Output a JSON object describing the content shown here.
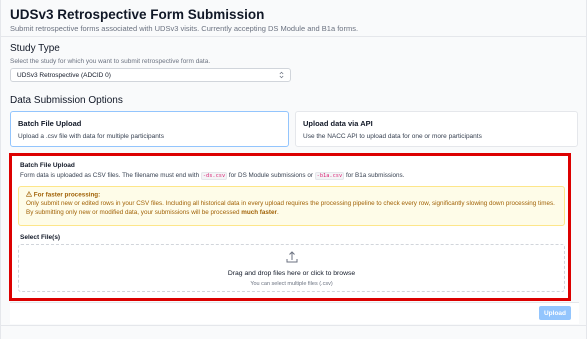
{
  "header": {
    "title": "UDSv3 Retrospective Form Submission",
    "subtitle": "Submit retrospective forms associated with UDSv3 visits. Currently accepting DS Module and B1a forms."
  },
  "study_type": {
    "heading": "Study Type",
    "help": "Select the study for which you want to submit retrospective form data.",
    "selected": "UDSv3 Retrospective (ADCID 0)",
    "chevron": "⌃⌄"
  },
  "options": {
    "heading": "Data Submission Options",
    "cards": [
      {
        "title": "Batch File Upload",
        "desc": "Upload a .csv file with data for multiple participants",
        "active": true
      },
      {
        "title": "Upload data via API",
        "desc": "Use the NACC API to upload data for one or more participants",
        "active": false
      }
    ]
  },
  "batch": {
    "title": "Batch File Upload",
    "desc_part1": "Form data is uploaded as CSV files. The filename must end with",
    "code1": "-ds.csv",
    "desc_part2": "for DS Module submissions or",
    "code2": "-b1a.csv",
    "desc_part3": "for B1a submissions.",
    "warning": {
      "title": "For faster processing:",
      "line1": "Only submit new or edited rows in your CSV files. Including all historical data in every upload requires the processing pipeline to check every row, significantly slowing down processing times.",
      "line2_start": "By submitting only new or modified data, your submissions will be processed",
      "line2_bold": "much faster",
      "line2_end": "."
    },
    "files_label": "Select File(s)",
    "dropzone_main": "Drag and drop files here or click to browse",
    "dropzone_sub": "You can select multiple files (.csv)"
  },
  "footer": {
    "upload_label": "Upload"
  },
  "colors": {
    "accent": "#93c5fd",
    "highlight": "#dc0000",
    "warning_bg": "#fefce8",
    "warning_text": "#a16207"
  }
}
